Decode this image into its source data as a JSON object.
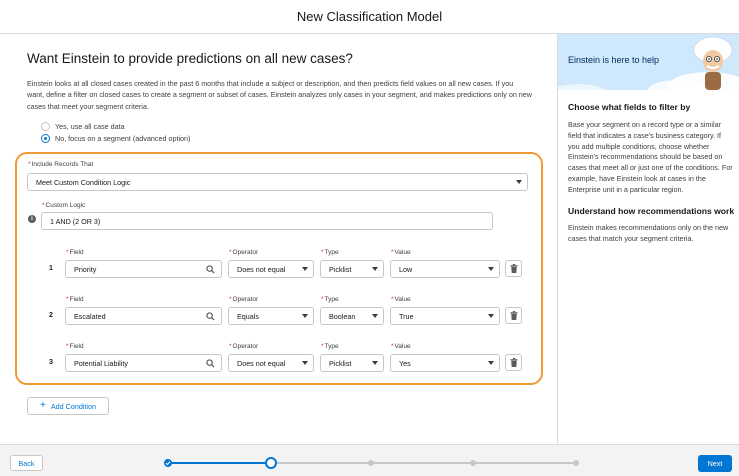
{
  "dialog": {
    "title": "New Classification Model"
  },
  "main": {
    "question": "Want Einstein to provide predictions on all new cases?",
    "description": "Einstein looks at all closed cases created in the past 6 months that include a subject or description, and then predicts field values on all new cases. If you want, define a filter on closed cases to create a segment or subset of cases. Einstein analyzes only cases in your segment, and makes predictions only on new cases that meet your segment criteria.",
    "radios": [
      {
        "label": "Yes, use all case data",
        "selected": false
      },
      {
        "label": "No, focus on a segment (advanced option)",
        "selected": true
      }
    ]
  },
  "segment": {
    "include_label": "Include Records That",
    "include_value": "Meet Custom Condition Logic",
    "logic_label": "Custom Logic",
    "logic_value": "1 AND (2 OR 3)",
    "info_glyph": "i",
    "headers": {
      "field": "Field",
      "operator": "Operator",
      "type": "Type",
      "value": "Value"
    },
    "conditions": [
      {
        "num": "1",
        "field": "Priority",
        "operator": "Does not equal",
        "type": "Picklist",
        "value": "Low"
      },
      {
        "num": "2",
        "field": "Escalated",
        "operator": "Equals",
        "type": "Boolean",
        "value": "True"
      },
      {
        "num": "3",
        "field": "Potential Liability",
        "operator": "Does not equal",
        "type": "Picklist",
        "value": "Yes"
      }
    ],
    "add_condition": "Add Condition",
    "add_glyph": "+"
  },
  "sidebar": {
    "help_title": "Einstein is here to help",
    "h1": "Choose what fields to filter by",
    "p1": "Base your segment on a record type or a similar field that indicates a case's business category. If you add multiple conditions, choose whether Einstein's recommendations should be based on cases that meet all or just one of the conditions. For example, have Einstein look at cases in the Enterprise unit in a particular region.",
    "h2": "Understand how recommendations work",
    "p2": "Einstein makes recommendations only on the new cases that match your segment criteria."
  },
  "footer": {
    "back": "Back",
    "next": "Next",
    "steps_total": 5,
    "current_step": 2
  },
  "icons": [
    "info-icon",
    "search-icon",
    "chevron-down-icon",
    "trash-icon",
    "plus-icon",
    "check-icon",
    "einstein-avatar"
  ],
  "colors": {
    "accent": "#0176d3",
    "highlight": "#f09a36",
    "required": "#c23934",
    "banner": "#cfe8fb"
  }
}
